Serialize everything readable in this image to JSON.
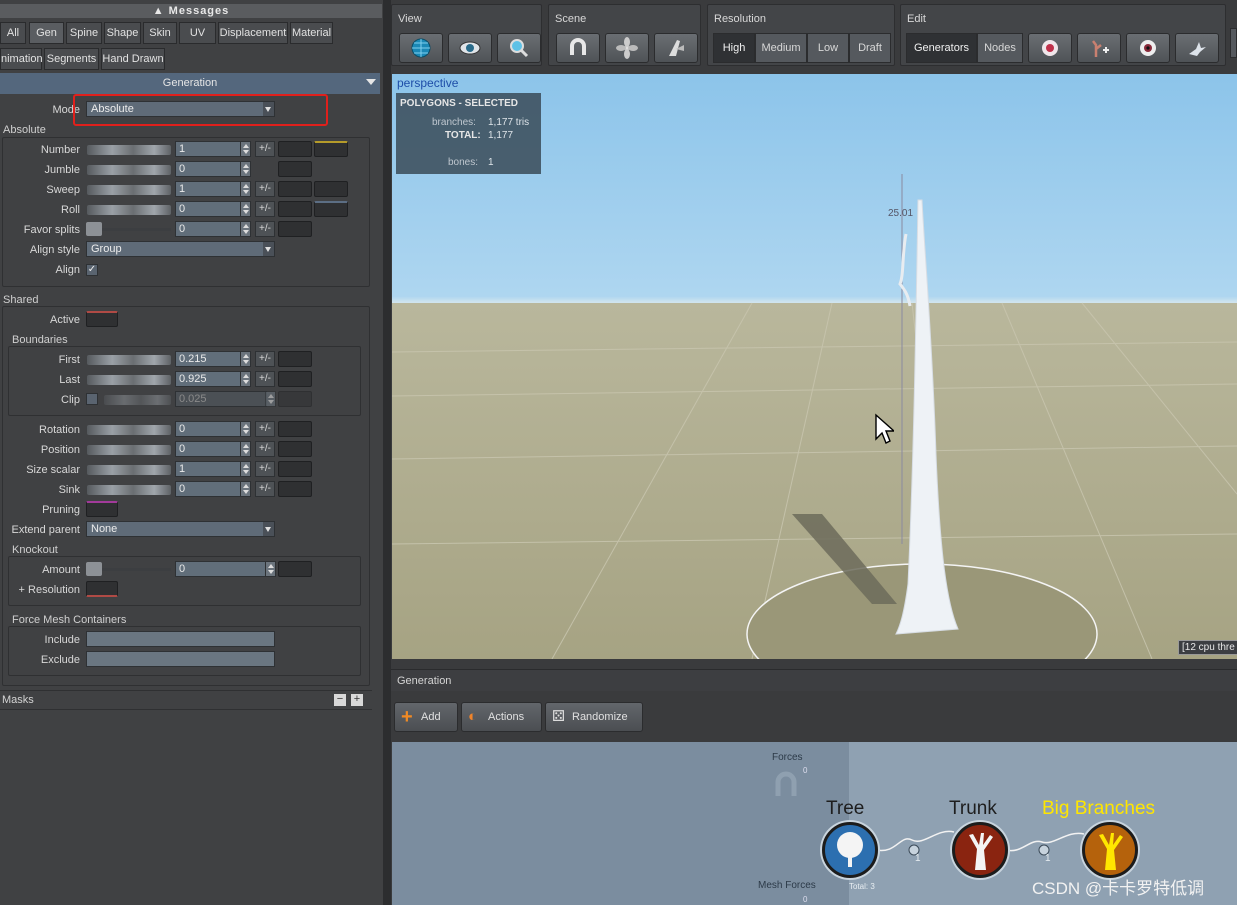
{
  "messages_label": "Messages",
  "tabs_row1": [
    "All",
    "Gen",
    "Spine",
    "Shape",
    "Skin",
    "UV",
    "Displacement",
    "Material"
  ],
  "tabs_row2": [
    "nimation",
    "Segments",
    "Hand Drawn"
  ],
  "generation_header": "Generation",
  "mode": {
    "label": "Mode",
    "value": "Absolute"
  },
  "absolute": {
    "title": "Absolute",
    "number": {
      "label": "Number",
      "value": "1"
    },
    "jumble": {
      "label": "Jumble",
      "value": "0"
    },
    "sweep": {
      "label": "Sweep",
      "value": "1"
    },
    "roll": {
      "label": "Roll",
      "value": "0"
    },
    "favor_splits": {
      "label": "Favor splits",
      "value": "0"
    },
    "align_style": {
      "label": "Align style",
      "value": "Group"
    },
    "align": {
      "label": "Align",
      "checked": true
    }
  },
  "shared": {
    "title": "Shared",
    "active_label": "Active",
    "boundaries_title": "Boundaries",
    "first": {
      "label": "First",
      "value": "0.215"
    },
    "last": {
      "label": "Last",
      "value": "0.925"
    },
    "clip": {
      "label": "Clip",
      "value": "0.025"
    },
    "rotation": {
      "label": "Rotation",
      "value": "0"
    },
    "position": {
      "label": "Position",
      "value": "0"
    },
    "size_scalar": {
      "label": "Size scalar",
      "value": "1"
    },
    "sink": {
      "label": "Sink",
      "value": "0"
    },
    "pruning_label": "Pruning",
    "extend_parent": {
      "label": "Extend parent",
      "value": "None"
    },
    "knockout_title": "Knockout",
    "amount": {
      "label": "Amount",
      "value": "0"
    },
    "resolution_label": "+ Resolution",
    "force_mesh_title": "Force Mesh Containers",
    "include_label": "Include",
    "exclude_label": "Exclude"
  },
  "plusminus": "+/-",
  "masks_label": "Masks",
  "toolbar": {
    "view_title": "View",
    "scene_title": "Scene",
    "resolution_title": "Resolution",
    "resolution_options": [
      "High",
      "Medium",
      "Low",
      "Draft"
    ],
    "resolution_selected": "High",
    "edit_title": "Edit",
    "edit_modes": [
      "Generators",
      "Nodes"
    ]
  },
  "viewport": {
    "label": "perspective",
    "stats_title": "POLYGONS - SELECTED",
    "branches_label": "branches:",
    "branches_value": "1,177 tris",
    "total_label": "TOTAL:",
    "total_value": "1,177",
    "bones_label": "bones:",
    "bones_value": "1",
    "height_marker": "25.01",
    "cpu_label": "[12 cpu thre"
  },
  "generation_panel": {
    "title": "Generation",
    "add_label": "Add",
    "actions_label": "Actions",
    "randomize_label": "Randomize",
    "forces_label": "Forces",
    "forces_count": "0",
    "mesh_forces_label": "Mesh Forces",
    "mesh_forces_count": "0",
    "total_label": "Total: 3",
    "nodes": [
      {
        "title": "Tree",
        "color": "#1e1e1e"
      },
      {
        "title": "Trunk",
        "color": "#1e1e1e",
        "count": "1"
      },
      {
        "title": "Big Branches",
        "color": "#ffe600",
        "count": "1"
      }
    ]
  },
  "watermark": "CSDN @卡卡罗特低调",
  "colors": {
    "highlight_box": "#e0201c",
    "panel_header": "#54677d",
    "node_tree": "#2c6fb0",
    "node_trunk": "#8a2410",
    "node_branch": "#b5620c"
  }
}
